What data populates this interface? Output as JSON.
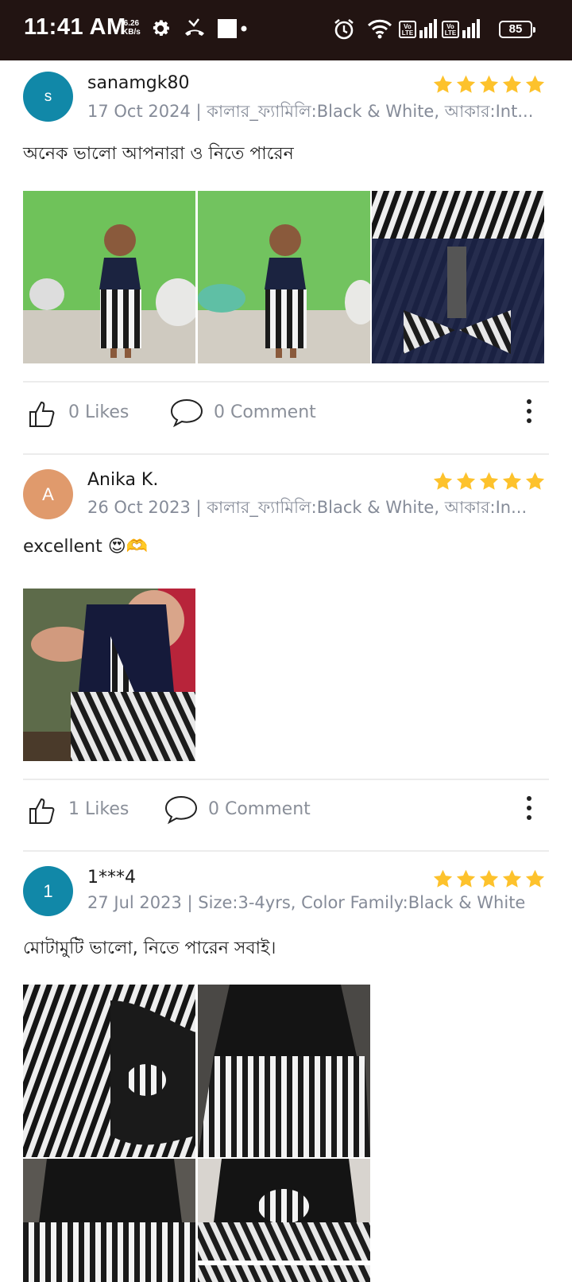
{
  "status_bar": {
    "time": "11:41 AM",
    "speed_value": "6.26",
    "speed_unit": "KB/s",
    "volte1": "Vo LTE",
    "volte2": "Vo LTE",
    "battery": "85",
    "icons": [
      "gear-icon",
      "missed-call-icon",
      "square-notification-icon",
      "alarm-icon",
      "wifi-icon",
      "signal-icon",
      "battery-icon"
    ]
  },
  "colors": {
    "star": "#FDC22C",
    "avatar_teal": "#1188A8",
    "avatar_orange": "#E09A6C",
    "meta": "#858B98"
  },
  "reviews": [
    {
      "avatar_letter": "s",
      "username": "sanamgk80",
      "rating": 5,
      "meta": "17 Oct 2024 | কালার_ফ্যামিলি:Black & White, আকার:Int...",
      "text": "অনেক ভালো আপনারা ও নিতে পারেন",
      "photo_count": 3,
      "likes": "0 Likes",
      "comments": "0 Comment"
    },
    {
      "avatar_letter": "A",
      "username": "Anika K.",
      "rating": 5,
      "meta": "26 Oct 2023 | কালার_ফ্যামিলি:Black & White, আকার:In...",
      "text": "excellent 😍🫶",
      "photo_count": 1,
      "likes": "1 Likes",
      "comments": "0 Comment"
    },
    {
      "avatar_letter": "1",
      "username": "1***4",
      "rating": 5,
      "meta": "27 Jul 2023 | Size:3-4yrs, Color Family:Black & White",
      "text": "মোটামুটি ভালো, নিতে পারেন সবাই।",
      "photo_count": 4
    }
  ]
}
